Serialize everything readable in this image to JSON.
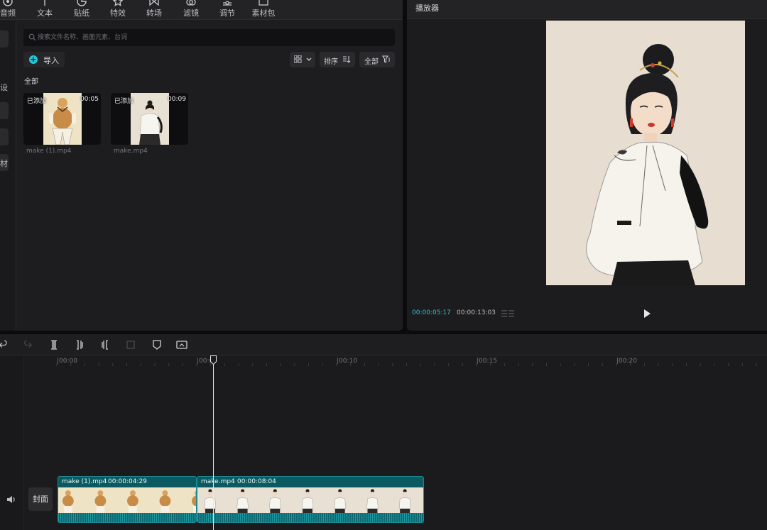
{
  "top_tabs": [
    {
      "label": "音频",
      "icon": "audio-icon"
    },
    {
      "label": "文本",
      "icon": "text-icon"
    },
    {
      "label": "贴纸",
      "icon": "sticker-icon"
    },
    {
      "label": "特效",
      "icon": "effects-icon"
    },
    {
      "label": "转场",
      "icon": "transition-icon"
    },
    {
      "label": "滤镜",
      "icon": "filter-icon"
    },
    {
      "label": "调节",
      "icon": "adjust-icon"
    },
    {
      "label": "素材包",
      "icon": "package-icon"
    }
  ],
  "side_rail": {
    "label_a": "设",
    "label_b": "材"
  },
  "search": {
    "placeholder": "搜索文件名称、画面元素、台词"
  },
  "import_label": "导入",
  "toolbar": {
    "sort_label": "排序",
    "filter_label": "全部"
  },
  "section_label": "全部",
  "media_items": [
    {
      "name": "make (1).mp4",
      "duration": "00:05",
      "badge": "已添加"
    },
    {
      "name": "make.mp4",
      "duration": "00:09",
      "badge": "已添加"
    }
  ],
  "player": {
    "title": "播放器",
    "current_time": "00:00:05:17",
    "total_time": "00:00:13:03"
  },
  "ruler_labels": [
    "|00:00",
    "|00:05",
    "|00:10",
    "|00:15",
    "|00:20"
  ],
  "cover_label": "封面",
  "clips": [
    {
      "name": "make (1).mp4",
      "timecode": "00:00:04:29"
    },
    {
      "name": "make.mp4",
      "timecode": "00:00:08:04"
    }
  ],
  "colors": {
    "accent": "#22c7d6",
    "clip": "#0f6b73",
    "panel": "#1d1d1f"
  }
}
